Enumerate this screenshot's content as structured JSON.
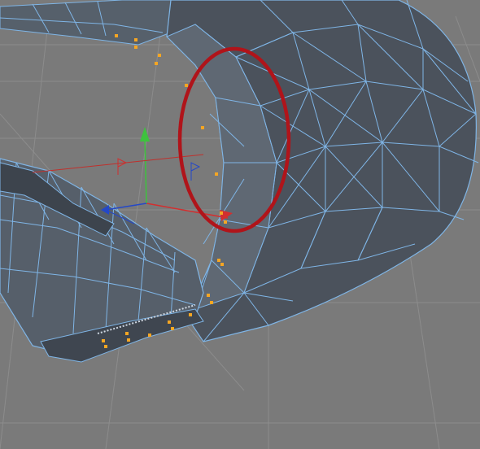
{
  "viewport": {
    "background": "#7a7a7a",
    "grid_color": "#8c8c8c",
    "mesh_fill": "#4b525c",
    "mesh_fill_light": "#5f6873",
    "wire_color": "#7fb5e6",
    "selected_point_color": "#f5a623",
    "annotation_color": "#b0141a",
    "axis_x_color": "#d32f2f",
    "axis_y_color": "#3ec23e",
    "axis_z_color": "#2448c8"
  },
  "mesh": {
    "object": "polygon-torus-section",
    "selected_point_count": 22
  },
  "gizmo": {
    "axes": [
      "x-axis",
      "y-axis",
      "z-axis"
    ]
  },
  "annotation": {
    "shape": "ellipse",
    "purpose": "highlight-problem-area"
  }
}
